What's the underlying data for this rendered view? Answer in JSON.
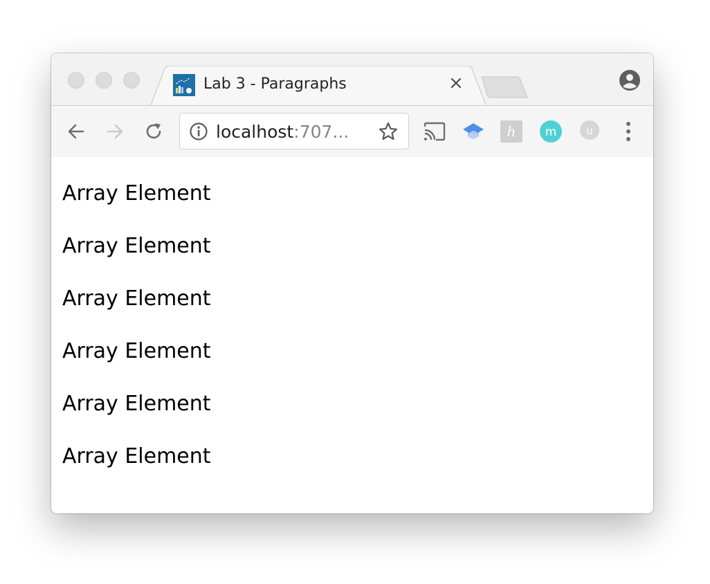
{
  "browser": {
    "tab": {
      "title": "Lab 3 - Paragraphs",
      "favicon": "chart-favicon-icon",
      "close_icon": "close-icon"
    },
    "address_bar": {
      "host": "localhost",
      "rest": ":707...",
      "info_icon": "info-icon",
      "bookmark_icon": "star-icon"
    },
    "nav": {
      "back_icon": "back-arrow-icon",
      "forward_icon": "forward-arrow-icon",
      "reload_icon": "reload-icon"
    },
    "extensions": [
      {
        "name": "cast-icon"
      },
      {
        "name": "graduation-cap-icon"
      },
      {
        "name": "h-extension-icon",
        "glyph": "h"
      },
      {
        "name": "m-extension-icon",
        "glyph": "m"
      },
      {
        "name": "u-extension-icon",
        "glyph": "u"
      }
    ],
    "colors": {
      "teal_extension": "#4fd1d4",
      "favicon_bg": "#1f6fa8"
    }
  },
  "page": {
    "paragraphs": [
      "Array Element",
      "Array Element",
      "Array Element",
      "Array Element",
      "Array Element",
      "Array Element"
    ]
  }
}
